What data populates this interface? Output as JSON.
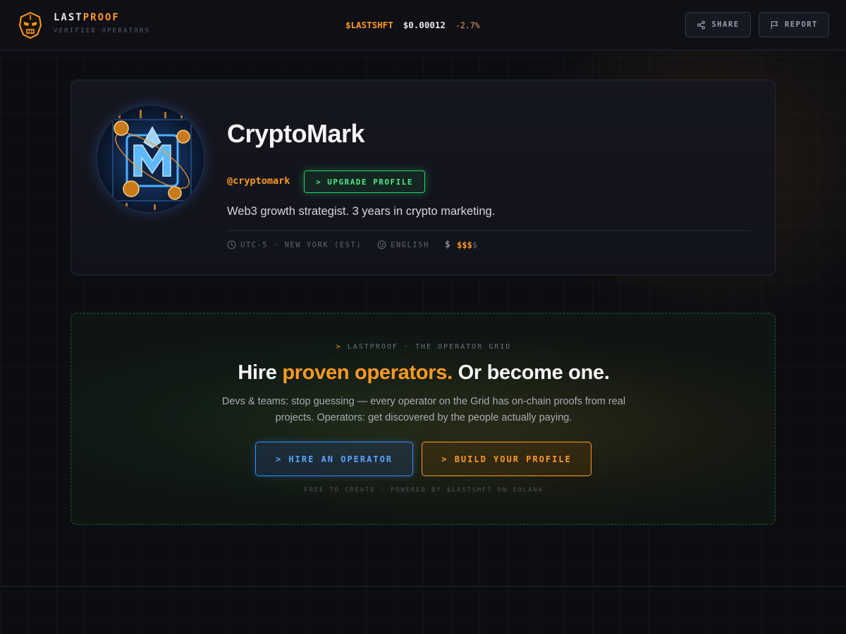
{
  "brand": {
    "name_part1": "LAST",
    "name_part2": "PROOF",
    "subtitle": "VERIFIED OPERATORS"
  },
  "ticker": {
    "symbol": "$LASTSHFT",
    "price": "$0.00012",
    "change": "-2.7%"
  },
  "header_actions": {
    "share_label": "SHARE",
    "report_label": "REPORT"
  },
  "profile": {
    "name": "CryptoMark",
    "handle": "@cryptomark",
    "upgrade_label": "> UPGRADE PROFILE",
    "bio": "Web3 growth strategist. 3 years in crypto marketing.",
    "timezone": "UTC-5 · NEW YORK (EST)",
    "language": "ENGLISH",
    "price_tier_active": "$$$",
    "price_tier_inactive": "$"
  },
  "cta": {
    "eyebrow_prefix": ">",
    "eyebrow": "LASTPROOF · THE OPERATOR GRID",
    "title_part1": "Hire ",
    "title_highlight": "proven operators.",
    "title_part2": " Or become one.",
    "description": "Devs & teams: stop guessing — every operator on the Grid has on-chain proofs from real projects. Operators: get discovered by the people actually paying.",
    "hire_label": "> HIRE AN OPERATOR",
    "build_label": "> BUILD YOUR PROFILE",
    "footnote": "FREE TO CREATE · POWERED BY $LASTSHFT ON SOLANA"
  },
  "colors": {
    "accent_orange": "#ff9a1f",
    "accent_green": "#2fd06a",
    "accent_blue": "#3d8cff",
    "background": "#0c0d12"
  },
  "icons": {
    "logo": "robot-mask-icon",
    "share": "share-icon",
    "report": "flag-icon",
    "timezone": "clock-icon",
    "language": "smiley-icon",
    "price": "dollar-icon"
  }
}
